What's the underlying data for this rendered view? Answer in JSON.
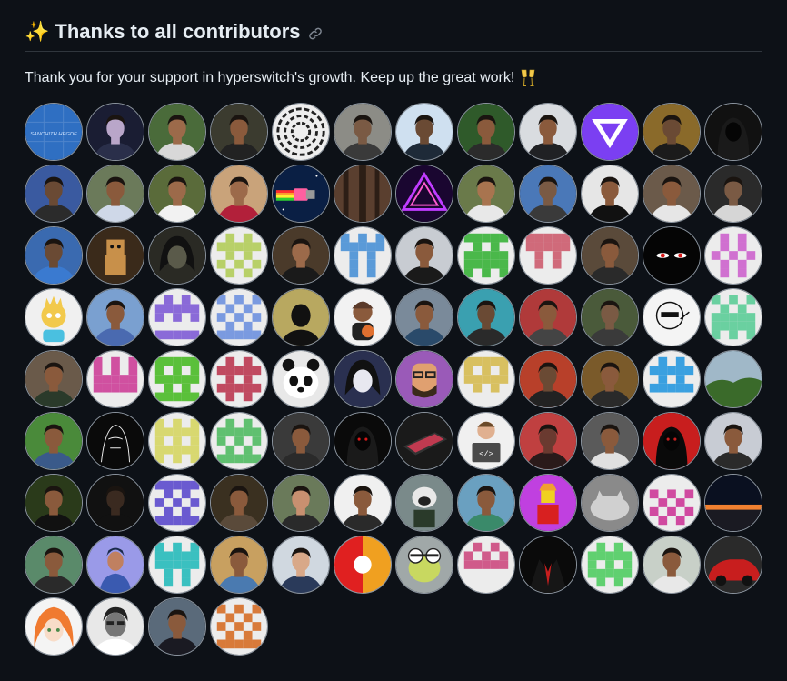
{
  "section": {
    "title": "Thanks to all contributors",
    "subtitle": "Thank you for your support in hyperswitch's growth. Keep up the great work!"
  },
  "contributors": [
    {
      "kind": "text",
      "bg": "#2f6fc2",
      "fg": "#cfe3ff",
      "label": "SANCHITH HEGDE"
    },
    {
      "kind": "photo",
      "bg": "#1a1d33",
      "skin": "#b9a6c9",
      "shirt": "#2a2f4a"
    },
    {
      "kind": "photo",
      "bg": "#4a6b3a",
      "skin": "#9c6a4a",
      "shirt": "#d8d8d8"
    },
    {
      "kind": "photo",
      "bg": "#3b3b2f",
      "skin": "#8a5a3c",
      "shirt": "#222222"
    },
    {
      "kind": "spiral",
      "bg": "#eeeeee",
      "fg": "#222222"
    },
    {
      "kind": "photo",
      "bg": "#8c8c86",
      "skin": "#7a5a44",
      "shirt": "#3a3a3a"
    },
    {
      "kind": "photo",
      "bg": "#cfe0f0",
      "skin": "#6a4a34",
      "shirt": "#1e2a38"
    },
    {
      "kind": "photo",
      "bg": "#2f5a2a",
      "skin": "#8a5a3c",
      "shirt": "#2b2b2b"
    },
    {
      "kind": "photo",
      "bg": "#d9dce0",
      "skin": "#8a5a3c",
      "shirt": "#202124"
    },
    {
      "kind": "logo",
      "bg": "#7b3ff2",
      "fg": "#ffffff"
    },
    {
      "kind": "photo",
      "bg": "#8a6a2a",
      "skin": "#6a4a34",
      "shirt": "#1b1b1b"
    },
    {
      "kind": "hood",
      "bg": "#111111",
      "fg": "#2a2a2a"
    },
    {
      "kind": "photo",
      "bg": "#3a5aa0",
      "skin": "#6a4a34",
      "shirt": "#2b2b2b"
    },
    {
      "kind": "photo",
      "bg": "#6b7a5a",
      "skin": "#8a5a3c",
      "shirt": "#cfd8e8"
    },
    {
      "kind": "photo",
      "bg": "#5a6b3a",
      "skin": "#9c6a4a",
      "shirt": "#f2f2f2"
    },
    {
      "kind": "photo",
      "bg": "#c9a37a",
      "skin": "#9c6a4a",
      "shirt": "#b2203a"
    },
    {
      "kind": "nyan",
      "bg": "#0a1f44",
      "fg": "#ff5fa0"
    },
    {
      "kind": "forest",
      "bg": "#5a3f2f",
      "fg": "#2c1e16"
    },
    {
      "kind": "tri",
      "bg": "#1a0630",
      "fg": "#c03cff"
    },
    {
      "kind": "photo",
      "bg": "#6a7a4a",
      "skin": "#a8744f",
      "shirt": "#e8e8e8"
    },
    {
      "kind": "photo",
      "bg": "#4a78b8",
      "skin": "#7a5a44",
      "shirt": "#3a3a3a"
    },
    {
      "kind": "photo",
      "bg": "#e6e6e6",
      "skin": "#8a5a3c",
      "shirt": "#111111"
    },
    {
      "kind": "photo",
      "bg": "#6b5a4a",
      "skin": "#8a5a3c",
      "shirt": "#e6e6e6"
    },
    {
      "kind": "photo",
      "bg": "#2a2a2a",
      "skin": "#7a5a44",
      "shirt": "#d6d6d6"
    },
    {
      "kind": "photo",
      "bg": "#3a6ab0",
      "skin": "#6a4a34",
      "shirt": "#3a7ad0"
    },
    {
      "kind": "boxbot",
      "bg": "#3a2a1a",
      "fg": "#c8904a"
    },
    {
      "kind": "anime",
      "bg": "#2a2a24",
      "fg": "#5a5a4a"
    },
    {
      "kind": "ident",
      "bg": "#ececec",
      "fg": "#b8d068",
      "p": [
        0,
        1,
        0,
        1,
        1,
        1,
        0,
        1,
        0,
        1,
        0,
        1,
        0,
        1,
        0
      ]
    },
    {
      "kind": "photo",
      "bg": "#4a3a2a",
      "skin": "#9c6a4a",
      "shirt": "#1a1a1a"
    },
    {
      "kind": "ident",
      "bg": "#ececec",
      "fg": "#5a9ad8",
      "p": [
        1,
        0,
        1,
        1,
        1,
        1,
        0,
        1,
        0,
        0,
        1,
        0,
        0,
        1,
        0
      ]
    },
    {
      "kind": "photo",
      "bg": "#c8ccd2",
      "skin": "#8a5a3c",
      "shirt": "#1a1a1a"
    },
    {
      "kind": "ident",
      "bg": "#ececec",
      "fg": "#4ab84a",
      "p": [
        1,
        1,
        1,
        0,
        1,
        0,
        1,
        1,
        1,
        1,
        1,
        1,
        1,
        0,
        1
      ]
    },
    {
      "kind": "ident",
      "bg": "#ececec",
      "fg": "#d06a7a",
      "p": [
        1,
        1,
        1,
        1,
        1,
        1,
        0,
        1,
        0,
        0,
        1,
        0,
        0,
        0,
        0
      ]
    },
    {
      "kind": "photo",
      "bg": "#5a4a3a",
      "skin": "#8a5a3c",
      "shirt": "#2a2a2a"
    },
    {
      "kind": "eyes",
      "bg": "#050505",
      "fg": "#d81818"
    },
    {
      "kind": "ident",
      "bg": "#ececec",
      "fg": "#d070d0",
      "p": [
        0,
        1,
        0,
        0,
        1,
        0,
        1,
        0,
        1,
        0,
        1,
        0,
        0,
        1,
        0
      ]
    },
    {
      "kind": "cartoon",
      "bg": "#f0f0f0",
      "fg": "#f2c94c"
    },
    {
      "kind": "photo",
      "bg": "#7aa0d0",
      "skin": "#8a5a3c",
      "shirt": "#4a6ab0"
    },
    {
      "kind": "ident",
      "bg": "#ececec",
      "fg": "#8a6ad8",
      "p": [
        0,
        1,
        0,
        1,
        1,
        1,
        1,
        0,
        1,
        0,
        0,
        0,
        1,
        1,
        1
      ]
    },
    {
      "kind": "ident",
      "bg": "#ececec",
      "fg": "#7a9ae0",
      "p": [
        1,
        0,
        1,
        0,
        1,
        0,
        1,
        0,
        1,
        0,
        1,
        0,
        1,
        1,
        1
      ]
    },
    {
      "kind": "silhouette",
      "bg": "#b8a860",
      "fg": "#111111"
    },
    {
      "kind": "cartoon2",
      "bg": "#f2f2f2",
      "fg": "#5a3a2a"
    },
    {
      "kind": "photo",
      "bg": "#7a8a9a",
      "skin": "#8a5a3c",
      "shirt": "#2a4a6a"
    },
    {
      "kind": "photo",
      "bg": "#3aa0b0",
      "skin": "#6a4a34",
      "shirt": "#2a2a2a"
    },
    {
      "kind": "photo",
      "bg": "#b03a3a",
      "skin": "#8a5a3c",
      "shirt": "#444444"
    },
    {
      "kind": "photo",
      "bg": "#4a5a3a",
      "skin": "#7a5a44",
      "shirt": "#3a3a3a"
    },
    {
      "kind": "sketch",
      "bg": "#f4f4f4",
      "fg": "#111111"
    },
    {
      "kind": "ident",
      "bg": "#ececec",
      "fg": "#6ad0a0",
      "p": [
        1,
        0,
        1,
        0,
        1,
        0,
        1,
        1,
        1,
        1,
        1,
        1,
        1,
        0,
        1
      ]
    },
    {
      "kind": "photo",
      "bg": "#6a5a4a",
      "skin": "#8a5a3c",
      "shirt": "#2a3a2a"
    },
    {
      "kind": "ident",
      "bg": "#ececec",
      "fg": "#d050a0",
      "p": [
        1,
        0,
        1,
        1,
        0,
        1,
        1,
        1,
        1,
        1,
        1,
        1,
        0,
        0,
        0
      ]
    },
    {
      "kind": "ident",
      "bg": "#ececec",
      "fg": "#5ac03a",
      "p": [
        1,
        1,
        1,
        1,
        0,
        1,
        1,
        1,
        1,
        0,
        1,
        0,
        1,
        1,
        1
      ]
    },
    {
      "kind": "ident",
      "bg": "#ececec",
      "fg": "#c04a60",
      "p": [
        0,
        1,
        0,
        1,
        1,
        1,
        0,
        1,
        0,
        1,
        1,
        1,
        0,
        1,
        0
      ]
    },
    {
      "kind": "panda",
      "bg": "#e8e8e8",
      "fg": "#111111"
    },
    {
      "kind": "anime2",
      "bg": "#2a3050",
      "fg": "#e8e8f0"
    },
    {
      "kind": "cartoon3",
      "bg": "#9a5ab8",
      "fg": "#e0a070"
    },
    {
      "kind": "ident",
      "bg": "#ececec",
      "fg": "#d8c060",
      "p": [
        1,
        1,
        1,
        1,
        0,
        1,
        1,
        1,
        1,
        0,
        1,
        0,
        0,
        0,
        0
      ]
    },
    {
      "kind": "photo",
      "bg": "#b8402a",
      "skin": "#6a4a34",
      "shirt": "#222222"
    },
    {
      "kind": "photo",
      "bg": "#7a5a2a",
      "skin": "#8a5a3c",
      "shirt": "#2a2a2a"
    },
    {
      "kind": "ident",
      "bg": "#ececec",
      "fg": "#3aa0e0",
      "p": [
        0,
        1,
        0,
        1,
        1,
        1,
        0,
        1,
        0,
        1,
        1,
        1,
        0,
        0,
        0
      ]
    },
    {
      "kind": "landscape",
      "bg": "#a0b8c8",
      "fg": "#3a6a2a"
    },
    {
      "kind": "photo",
      "bg": "#4a8a3a",
      "skin": "#8a5a3c",
      "shirt": "#3a5a8a"
    },
    {
      "kind": "sketch2",
      "bg": "#0a0a0a",
      "fg": "#f0f0f0"
    },
    {
      "kind": "ident",
      "bg": "#ececec",
      "fg": "#d8d870",
      "p": [
        1,
        0,
        1,
        1,
        1,
        1,
        1,
        0,
        1,
        1,
        1,
        1,
        1,
        0,
        1
      ]
    },
    {
      "kind": "ident",
      "bg": "#ececec",
      "fg": "#60c070",
      "p": [
        0,
        1,
        0,
        1,
        1,
        1,
        1,
        0,
        1,
        0,
        1,
        0,
        1,
        1,
        1
      ]
    },
    {
      "kind": "photo",
      "bg": "#3a3a3a",
      "skin": "#8a5a3c",
      "shirt": "#2a2a2a"
    },
    {
      "kind": "hood2",
      "bg": "#0a0a0a",
      "fg": "#d81818"
    },
    {
      "kind": "laptop",
      "bg": "#1a1a1a",
      "fg": "#c03a50"
    },
    {
      "kind": "coder",
      "bg": "#f0f0f0",
      "fg": "#4a4a4a"
    },
    {
      "kind": "photo",
      "bg": "#c04040",
      "skin": "#6a3a30",
      "shirt": "#2a1a1a"
    },
    {
      "kind": "photo",
      "bg": "#5a5a5a",
      "skin": "#8a5a3c",
      "shirt": "#e0e0e0"
    },
    {
      "kind": "hood3",
      "bg": "#c81e1e",
      "fg": "#0a0a0a"
    },
    {
      "kind": "photo",
      "bg": "#c8ccd4",
      "skin": "#8a5a3c",
      "shirt": "#2a2a2a"
    },
    {
      "kind": "photo",
      "bg": "#2a3a1a",
      "skin": "#8a5a3c",
      "shirt": "#111111"
    },
    {
      "kind": "photo",
      "bg": "#111111",
      "skin": "#3a2a20",
      "shirt": "#111111"
    },
    {
      "kind": "ident",
      "bg": "#ececec",
      "fg": "#6a5ad0",
      "p": [
        1,
        1,
        1,
        0,
        1,
        0,
        1,
        0,
        1,
        0,
        1,
        0,
        1,
        1,
        1
      ]
    },
    {
      "kind": "photo",
      "bg": "#3a3020",
      "skin": "#8a5a3c",
      "shirt": "#5a4a3a"
    },
    {
      "kind": "photo",
      "bg": "#6a7a5a",
      "skin": "#c89070",
      "shirt": "#2a2a2a"
    },
    {
      "kind": "photo",
      "bg": "#f0f0f0",
      "skin": "#8a5a3c",
      "shirt": "#2a2a2a"
    },
    {
      "kind": "pug",
      "bg": "#7a8a8a",
      "fg": "#2a3a2a"
    },
    {
      "kind": "photo",
      "bg": "#6aa0c0",
      "skin": "#8a5a3c",
      "shirt": "#3a8a6a"
    },
    {
      "kind": "roblox",
      "bg": "#c040e0",
      "fg": "#f0a030"
    },
    {
      "kind": "cat",
      "bg": "#8a8a8a",
      "fg": "#d0d0d0"
    },
    {
      "kind": "ident",
      "bg": "#ececec",
      "fg": "#d04aa0",
      "p": [
        0,
        0,
        0,
        1,
        0,
        1,
        0,
        1,
        0,
        1,
        0,
        1,
        0,
        1,
        0
      ]
    },
    {
      "kind": "sunset",
      "bg": "#0a1020",
      "fg": "#f08030"
    },
    {
      "kind": "photo",
      "bg": "#5a8a6a",
      "skin": "#8a5a3c",
      "shirt": "#2a2a2a"
    },
    {
      "kind": "flat",
      "bg": "#9a9ae8",
      "fg": "#1a2a4a"
    },
    {
      "kind": "ident",
      "bg": "#ececec",
      "fg": "#3ac0c0",
      "p": [
        1,
        0,
        1,
        1,
        1,
        1,
        1,
        1,
        1,
        0,
        1,
        0,
        0,
        1,
        0
      ]
    },
    {
      "kind": "photo",
      "bg": "#c8a060",
      "skin": "#8a5a3c",
      "shirt": "#4a7ab0"
    },
    {
      "kind": "photo",
      "bg": "#d0d8e0",
      "skin": "#d8a888",
      "shirt": "#2a3a5a"
    },
    {
      "kind": "wheel",
      "bg": "#f0f0f0",
      "fg": "#e02020"
    },
    {
      "kind": "frog",
      "bg": "#a0a8a8",
      "fg": "#c8d860"
    },
    {
      "kind": "ident",
      "bg": "#ececec",
      "fg": "#d05a8a",
      "p": [
        0,
        1,
        0,
        1,
        0,
        1,
        1,
        1,
        1,
        0,
        0,
        0,
        0,
        0,
        0
      ]
    },
    {
      "kind": "suit",
      "bg": "#0a0a0a",
      "fg": "#c81e1e"
    },
    {
      "kind": "ident",
      "bg": "#ececec",
      "fg": "#60d070",
      "p": [
        0,
        1,
        0,
        1,
        1,
        1,
        1,
        0,
        1,
        1,
        1,
        1,
        0,
        1,
        0
      ]
    },
    {
      "kind": "photo",
      "bg": "#c8d0c8",
      "skin": "#8a5a3c",
      "shirt": "#e8e8e8"
    },
    {
      "kind": "car",
      "bg": "#2a2a2a",
      "fg": "#c81e1e"
    },
    {
      "kind": "animegirl",
      "bg": "#f4f4f4",
      "fg": "#f07a30"
    },
    {
      "kind": "bw",
      "bg": "#e8e8e8",
      "fg": "#222222"
    },
    {
      "kind": "photo",
      "bg": "#5a6a7a",
      "skin": "#8a5a3c",
      "shirt": "#1a1a22"
    },
    {
      "kind": "ident",
      "bg": "#ececec",
      "fg": "#d87a3a",
      "p": [
        1,
        0,
        1,
        0,
        1,
        0,
        1,
        0,
        1,
        0,
        1,
        0,
        1,
        1,
        1
      ]
    }
  ]
}
